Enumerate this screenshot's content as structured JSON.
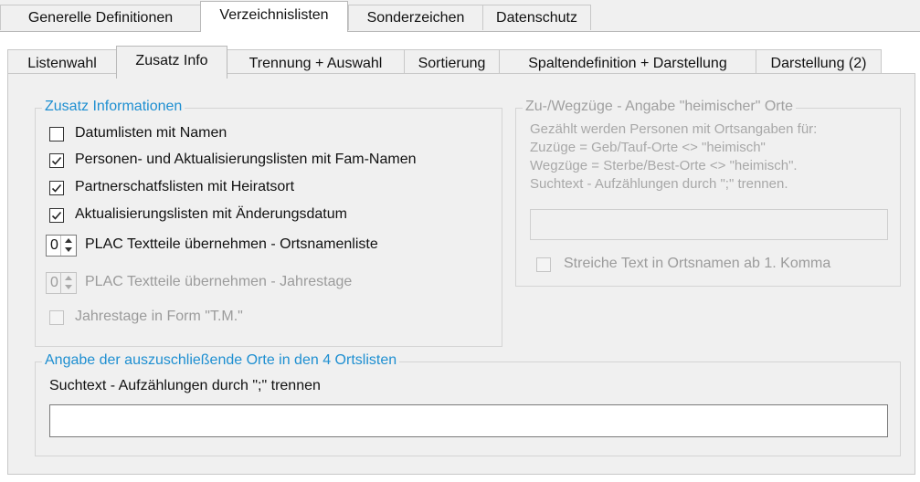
{
  "tabs_top": [
    "Generelle Definitionen",
    "Verzeichnislisten",
    "Sonderzeichen",
    "Datenschutz"
  ],
  "tabs_sub": [
    "Listenwahl",
    "Zusatz Info",
    "Trennung + Auswahl",
    "Sortierung",
    "Spaltendefinition + Darstellung",
    "Darstellung (2)"
  ],
  "zusatz": {
    "legend": "Zusatz Informationen",
    "checkboxes": [
      {
        "label": "Datumlisten mit Namen",
        "checked": false
      },
      {
        "label": "Personen- und Aktualisierungslisten mit Fam-Namen",
        "checked": true
      },
      {
        "label": "Partnerschatfslisten mit Heiratsort",
        "checked": true
      },
      {
        "label": "Aktualisierungslisten mit Änderungsdatum",
        "checked": true
      }
    ],
    "spinner1": {
      "value": "0",
      "label": "PLAC Textteile übernehmen - Ortsnamenliste"
    },
    "spinner2": {
      "value": "0",
      "label": "PLAC Textteile übernehmen - Jahrestage"
    },
    "jahrestage": {
      "label": "Jahrestage in Form \"T.M.\"",
      "checked": false
    }
  },
  "zuweg": {
    "legend": "Zu-/Wegzüge - Angabe \"heimischer\" Orte",
    "lines": [
      "Gezählt werden Personen mit Ortsangaben für:",
      "Zuzüge = Geb/Tauf-Orte <> \"heimisch\"",
      "Wegzüge = Sterbe/Best-Orte <> \"heimisch\".",
      "Suchtext - Aufzählungen durch \";\" trennen."
    ],
    "input_value": "",
    "checkbox_label": "Streiche Text in Ortsnamen ab 1. Komma"
  },
  "exclude": {
    "legend": "Angabe der auszuschließende Orte in den 4 Ortslisten",
    "label": "Suchtext - Aufzählungen durch \";\" trennen",
    "input_value": ""
  },
  "colors": {
    "legend_blue": "#1e8fd1",
    "disabled_text": "#9b9b9b"
  }
}
